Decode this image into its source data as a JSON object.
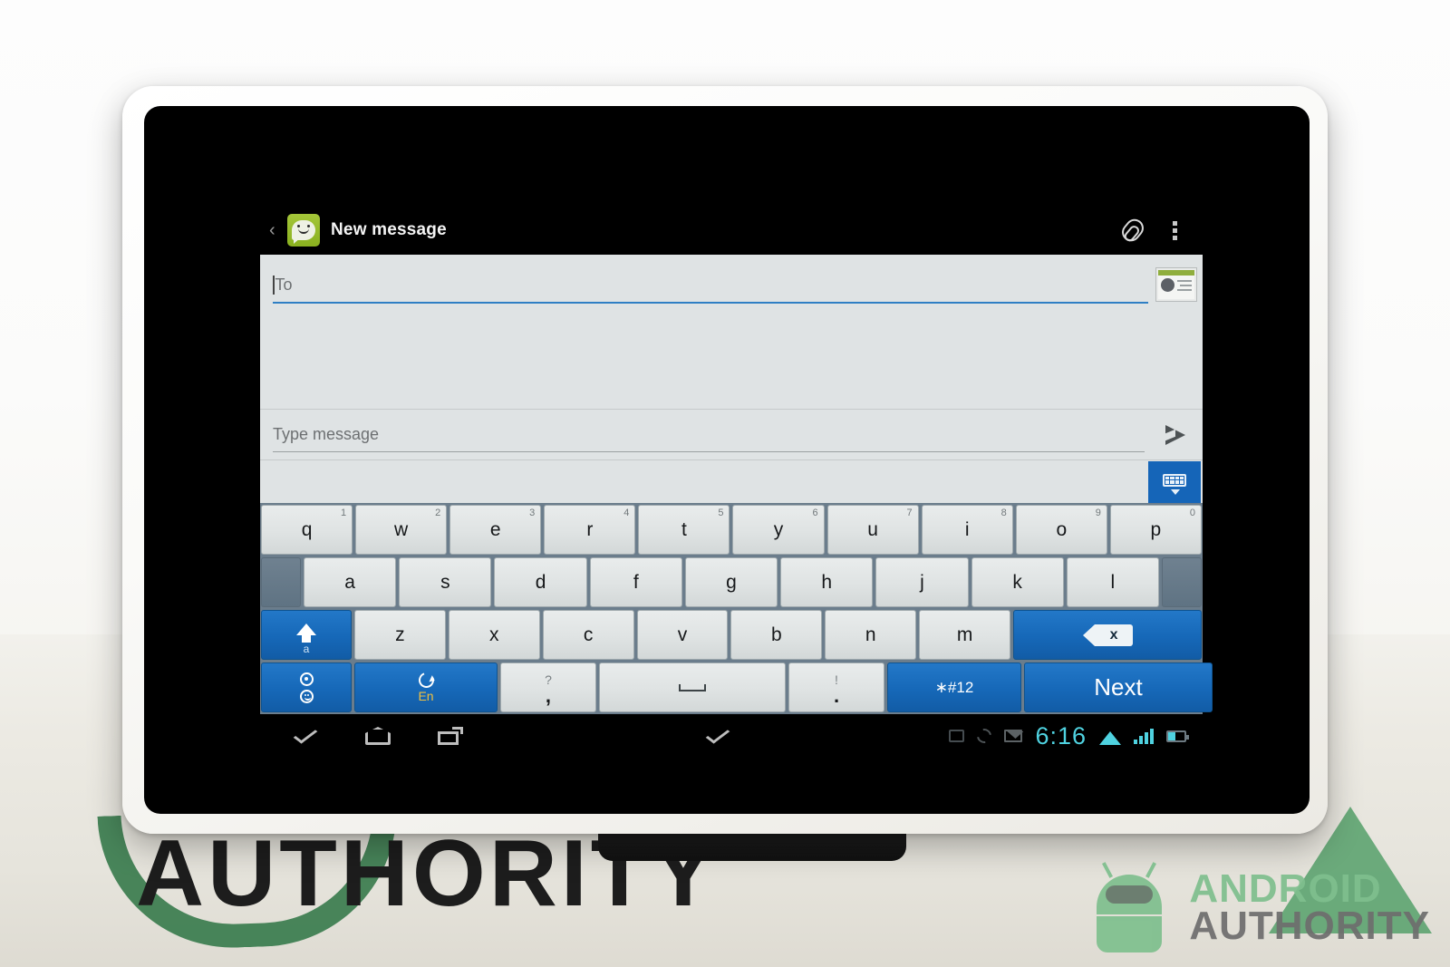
{
  "action_bar": {
    "back_label": "‹",
    "app_icon_name": "messaging-app-icon",
    "title": "New message",
    "attach_label": "",
    "overflow_label": ""
  },
  "compose": {
    "to_placeholder": "To",
    "to_value": "",
    "contact_picker_label": "",
    "message_placeholder": "Type message",
    "message_value": "",
    "send_label": "",
    "hide_keyboard_label": ""
  },
  "keyboard": {
    "row1": [
      {
        "label": "q",
        "sup": "1"
      },
      {
        "label": "w",
        "sup": "2"
      },
      {
        "label": "e",
        "sup": "3"
      },
      {
        "label": "r",
        "sup": "4"
      },
      {
        "label": "t",
        "sup": "5"
      },
      {
        "label": "y",
        "sup": "6"
      },
      {
        "label": "u",
        "sup": "7"
      },
      {
        "label": "i",
        "sup": "8"
      },
      {
        "label": "o",
        "sup": "9"
      },
      {
        "label": "p",
        "sup": "0"
      }
    ],
    "row2": [
      {
        "label": "a"
      },
      {
        "label": "s"
      },
      {
        "label": "d"
      },
      {
        "label": "f"
      },
      {
        "label": "g"
      },
      {
        "label": "h"
      },
      {
        "label": "j"
      },
      {
        "label": "k"
      },
      {
        "label": "l"
      }
    ],
    "row3_letters": [
      {
        "label": "z"
      },
      {
        "label": "x"
      },
      {
        "label": "c"
      },
      {
        "label": "v"
      },
      {
        "label": "b"
      },
      {
        "label": "n"
      },
      {
        "label": "m"
      }
    ],
    "shift_sub": "a",
    "backspace_label": "x",
    "lang_label": "En",
    "comma_upper": "?",
    "comma_lower": ",",
    "period_upper": "!",
    "period_lower": ".",
    "symbols_label": "∗#12",
    "enter_label": "Next",
    "space_label": ""
  },
  "nav_bar": {
    "hide_keyboard_label": "",
    "home_label": "",
    "recents_label": "",
    "extra_chevron_label": ""
  },
  "status_bar": {
    "clock": "6:16",
    "icons": [
      "notification-icon",
      "sync-icon",
      "gmail-icon",
      "wifi-icon",
      "signal-icon",
      "battery-icon"
    ]
  },
  "watermark": {
    "line1": "ANDROID",
    "line2": "AUTHORITY"
  },
  "backdrop": {
    "poster_text": "AUTHORITY"
  },
  "colors": {
    "accent_blue": "#1668b8",
    "keyboard_bg": "#6b7d8c",
    "clock_cyan": "#4fd2e0",
    "app_green": "#8ab11f",
    "watermark_green": "#7fbf8e"
  }
}
